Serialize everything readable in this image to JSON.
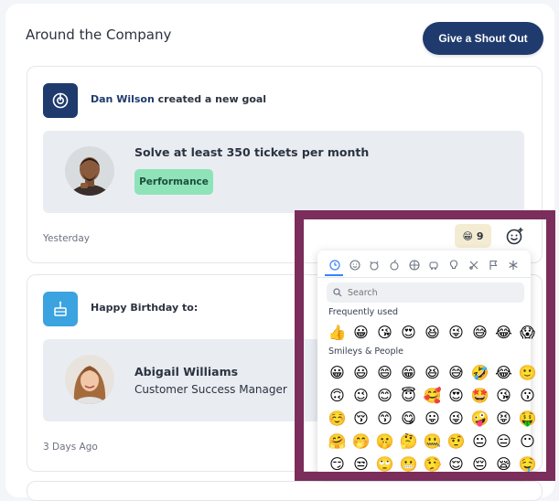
{
  "header": {
    "title": "Around the Company",
    "shout_out_label": "Give a Shout Out"
  },
  "card_goal": {
    "author": "Dan Wilson",
    "action": " created a new goal",
    "goal_title": "Solve at least 350 tickets per month",
    "tag": "Performance",
    "time": "Yesterday"
  },
  "card_birthday": {
    "headline": "Happy Birthday to:",
    "person_name": "Abigail Williams",
    "person_role": "Customer Success Manager",
    "time": "3 Days Ago"
  },
  "reaction": {
    "emoji": "😁",
    "count": "9"
  },
  "picker": {
    "search_placeholder": "Search",
    "frequently_used_label": "Frequently used",
    "smileys_label": "Smileys & People",
    "frequently_used": [
      "👍",
      "😀",
      "😘",
      "😍",
      "😆",
      "😜",
      "😅",
      "😂",
      "😱"
    ],
    "smileys_rows": [
      [
        "😀",
        "😃",
        "😄",
        "😁",
        "😆",
        "😅",
        "🤣",
        "😂",
        "🙂"
      ],
      [
        "🙃",
        "😉",
        "😊",
        "😇",
        "🥰",
        "😍",
        "🤩",
        "😘",
        "😗"
      ],
      [
        "☺️",
        "😚",
        "😙",
        "😋",
        "😛",
        "😜",
        "🤪",
        "😝",
        "🤑"
      ],
      [
        "🤗",
        "🤭",
        "🤫",
        "🤔",
        "🤐",
        "🤨",
        "😐",
        "😑",
        "😶"
      ],
      [
        "😏",
        "😒",
        "🙄",
        "😬",
        "🤥",
        "😌",
        "😔",
        "😪",
        "🤤"
      ]
    ]
  }
}
